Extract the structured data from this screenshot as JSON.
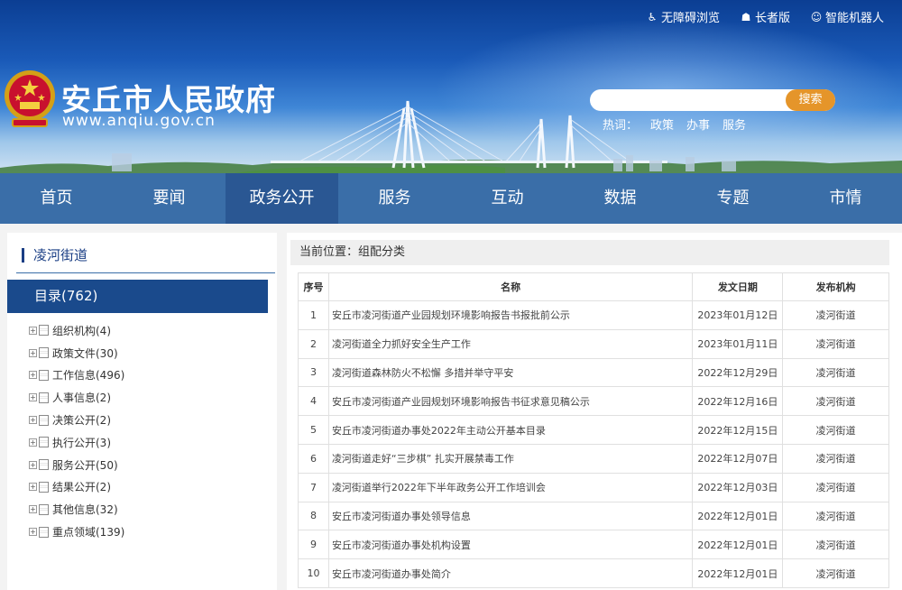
{
  "header": {
    "top_links": [
      {
        "icon": "accessibility-icon",
        "label": "无障碍浏览"
      },
      {
        "icon": "elder-icon",
        "label": "长者版"
      },
      {
        "icon": "robot-icon",
        "label": "智能机器人"
      }
    ],
    "site_name": "安丘市人民政府",
    "site_url": "www.anqiu.gov.cn",
    "search": {
      "placeholder": "",
      "button": "搜索"
    },
    "hot": {
      "label": "热词：",
      "words": [
        "政策",
        "办事",
        "服务"
      ]
    }
  },
  "nav": {
    "items": [
      "首页",
      "要闻",
      "政务公开",
      "服务",
      "互动",
      "数据",
      "专题",
      "市情"
    ],
    "active_index": 2
  },
  "sidebar": {
    "title": "凌河街道",
    "catalog": "目录(762)",
    "items": [
      "组织机构(4)",
      "政策文件(30)",
      "工作信息(496)",
      "人事信息(2)",
      "决策公开(2)",
      "执行公开(3)",
      "服务公开(50)",
      "结果公开(2)",
      "其他信息(32)",
      "重点领域(139)"
    ]
  },
  "main": {
    "breadcrumb": "当前位置：组配分类",
    "columns": [
      "序号",
      "名称",
      "发文日期",
      "发布机构"
    ],
    "rows": [
      {
        "idx": "1",
        "name": "安丘市凌河街道产业园规划环境影响报告书报批前公示",
        "date": "2023年01月12日",
        "org": "凌河街道"
      },
      {
        "idx": "2",
        "name": "凌河街道全力抓好安全生产工作",
        "date": "2023年01月11日",
        "org": "凌河街道"
      },
      {
        "idx": "3",
        "name": "凌河街道森林防火不松懈 多措并举守平安",
        "date": "2022年12月29日",
        "org": "凌河街道"
      },
      {
        "idx": "4",
        "name": "安丘市凌河街道产业园规划环境影响报告书征求意见稿公示",
        "date": "2022年12月16日",
        "org": "凌河街道"
      },
      {
        "idx": "5",
        "name": "安丘市凌河街道办事处2022年主动公开基本目录",
        "date": "2022年12月15日",
        "org": "凌河街道"
      },
      {
        "idx": "6",
        "name": "凌河街道走好“三步棋” 扎实开展禁毒工作",
        "date": "2022年12月07日",
        "org": "凌河街道"
      },
      {
        "idx": "7",
        "name": "凌河街道举行2022年下半年政务公开工作培训会",
        "date": "2022年12月03日",
        "org": "凌河街道"
      },
      {
        "idx": "8",
        "name": "安丘市凌河街道办事处领导信息",
        "date": "2022年12月01日",
        "org": "凌河街道"
      },
      {
        "idx": "9",
        "name": "安丘市凌河街道办事处机构设置",
        "date": "2022年12月01日",
        "org": "凌河街道"
      },
      {
        "idx": "10",
        "name": "安丘市凌河街道办事处简介",
        "date": "2022年12月01日",
        "org": "凌河街道"
      }
    ]
  }
}
